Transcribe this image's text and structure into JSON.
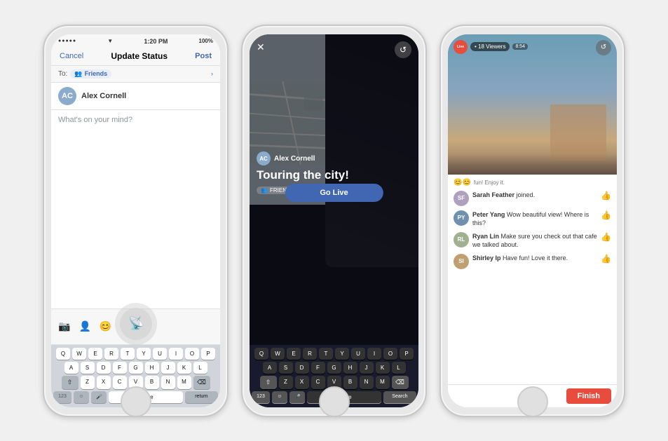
{
  "phone1": {
    "statusBar": {
      "dots": "●●●●●",
      "carrier": "▼",
      "time": "1:20 PM",
      "battery": "100%"
    },
    "navbar": {
      "cancel": "Cancel",
      "title": "Update Status",
      "post": "Post"
    },
    "toLabel": "To:",
    "friendsLabel": "Friends",
    "userName": "Alex Cornell",
    "placeholder": "What's on your mind?",
    "liveIconChar": "📡",
    "keyboard": {
      "row1": [
        "Q",
        "W",
        "E",
        "R",
        "T",
        "Y",
        "U",
        "I",
        "O",
        "P"
      ],
      "row2": [
        "A",
        "S",
        "D",
        "F",
        "G",
        "H",
        "J",
        "K",
        "L"
      ],
      "row3": [
        "Z",
        "X",
        "C",
        "V",
        "B",
        "N",
        "M"
      ],
      "spaceLabel": "space",
      "returnLabel": "return",
      "num123": "123",
      "shift": "⇧",
      "del": "⌫"
    }
  },
  "phone2": {
    "closeChar": "✕",
    "swapChar": "↺",
    "userName": "Alex Cornell",
    "title": "Touring the city!",
    "friendsLabel": "FRIENDS",
    "goLiveLabel": "Go Live",
    "keyboard": {
      "row1": [
        "Q",
        "W",
        "E",
        "R",
        "T",
        "Y",
        "U",
        "I",
        "O",
        "P"
      ],
      "row2": [
        "A",
        "S",
        "D",
        "F",
        "G",
        "H",
        "J",
        "K",
        "L"
      ],
      "row3": [
        "Z",
        "X",
        "C",
        "V",
        "B",
        "N",
        "M"
      ],
      "num123": "123",
      "shift": "⇧",
      "del": "⌫",
      "spaceLabel": "space",
      "searchLabel": "Search"
    }
  },
  "phone3": {
    "liveBadge": "Live",
    "viewers": "• 18 Viewers",
    "timer": "8:54",
    "swapChar": "↺",
    "reactionText": "fun! Enjoy it.",
    "comments": [
      {
        "name": "Sarah Feather",
        "text": "joined.",
        "avatarColor": "#b0a0c0",
        "initials": "SF"
      },
      {
        "name": "Peter Yang",
        "text": "Wow beautiful view! Where is this?",
        "avatarColor": "#7090b0",
        "initials": "PY"
      },
      {
        "name": "Ryan Lin",
        "text": "Make sure you check out that cafe we talked about.",
        "avatarColor": "#a0b090",
        "initials": "RL"
      },
      {
        "name": "Shirley Ip",
        "text": "Have fun! Love it there.",
        "avatarColor": "#c0a070",
        "initials": "SI"
      }
    ],
    "finishLabel": "Finish"
  }
}
